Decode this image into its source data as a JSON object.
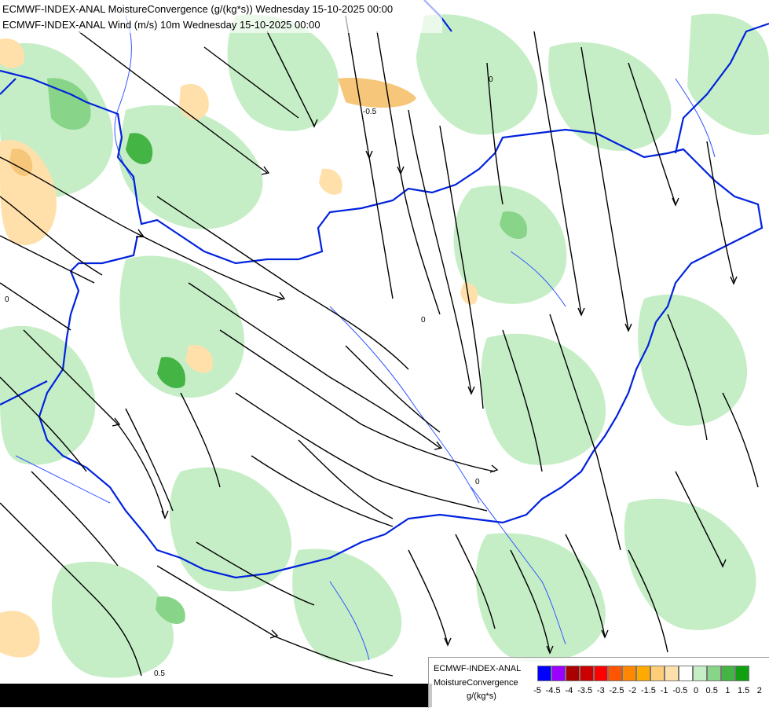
{
  "titles": {
    "line1": "ECMWF-INDEX-ANAL MoistureConvergence (g/(kg*s)) Wednesday 15-10-2025 00:00",
    "line2": "ECMWF-INDEX-ANAL Wind (m/s) 10m Wednesday 15-10-2025 00:00"
  },
  "legend": {
    "model": "ECMWF-INDEX-ANAL",
    "variable": "MoistureConvergence",
    "units": "g/(kg*s)",
    "ticks": [
      "-5",
      "-4.5",
      "-4",
      "-3.5",
      "-3",
      "-2.5",
      "-2",
      "-1.5",
      "-1",
      "-0.5",
      "0",
      "0.5",
      "1",
      "1.5",
      "2"
    ],
    "colors": [
      "#0000ff",
      "#9900ff",
      "#aa0000",
      "#cc0000",
      "#ff0000",
      "#ff5500",
      "#ff8800",
      "#ffaa00",
      "#ffcc77",
      "#ffe0aa",
      "#ffffff",
      "#c6eec6",
      "#88d488",
      "#44b444",
      "#11a011"
    ]
  },
  "contour_labels": [
    "-0.5",
    "0",
    "0.5",
    "0",
    "0",
    "0"
  ],
  "colors": {
    "border": "#0022dd",
    "river": "#3355ff",
    "positive_light": "#c6eec6",
    "positive_mid": "#88d488",
    "positive_dark": "#44b444",
    "negative_light": "#ffe0aa",
    "negative_mid": "#f6c77a"
  },
  "map_layers": [
    "moisture-convergence-field",
    "wind-streamlines",
    "country-borders",
    "rivers"
  ]
}
